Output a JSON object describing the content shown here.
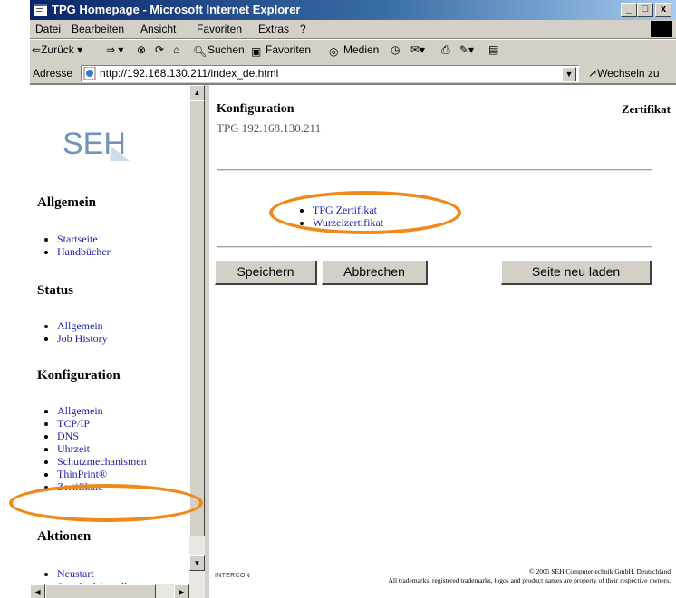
{
  "window": {
    "title": "TPG Homepage - Microsoft Internet Explorer",
    "min": "_",
    "max": "□",
    "close": "x"
  },
  "menu": [
    "Datei",
    "Bearbeiten",
    "Ansicht",
    "Favoriten",
    "Extras",
    "?"
  ],
  "toolbar": {
    "back": "Zurück",
    "search": "Suchen",
    "favorites": "Favoriten",
    "media": "Medien"
  },
  "address": {
    "label": "Adresse",
    "url": "http://192.168.130.211/index_de.html",
    "go": "Wechseln zu"
  },
  "nav": {
    "logo": "SEH",
    "sections": [
      {
        "title": "Allgemein",
        "items": [
          "Startseite",
          "Handbücher"
        ]
      },
      {
        "title": "Status",
        "items": [
          "Allgemein",
          "Job History"
        ]
      },
      {
        "title": "Konfiguration",
        "items": [
          "Allgemein",
          "TCP/IP",
          "DNS",
          "Uhrzeit",
          "Schutzmechanismen",
          "ThinPrint®",
          "Zertifikate"
        ]
      },
      {
        "title": "Aktionen",
        "items": [
          "Neustart",
          "Standardeinstellungen"
        ]
      }
    ]
  },
  "content": {
    "title": "Konfiguration",
    "subtitle": "TPG 192.168.130.211",
    "section": "Zertifikat",
    "links": [
      "TPG Zertifikat",
      "Wurzelzertifikat"
    ],
    "buttons": {
      "save": "Speichern",
      "cancel": "Abbrechen",
      "reload": "Seite neu laden"
    },
    "intercon": "INTERCON",
    "copyright": "© 2005 SEH Computertechnik GmbH, Deutschland",
    "trademarks": "All trademarks, registered trademarks, logos and product names are property of their respective owners."
  },
  "colors": {
    "highlight": "#ef8a1a",
    "link": "#1f1fb0",
    "titlebar": "#0a246a"
  }
}
